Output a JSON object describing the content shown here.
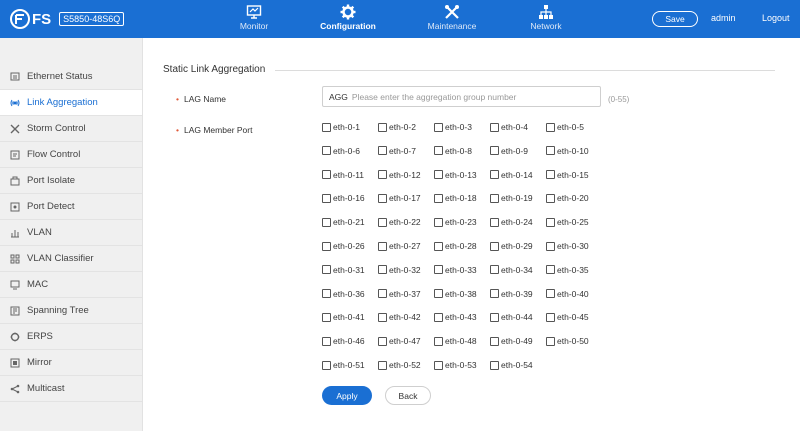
{
  "header": {
    "brand": "FS",
    "model": "S5850-48S6Q",
    "nav": [
      {
        "label": "Monitor",
        "icon": "monitor-icon"
      },
      {
        "label": "Configuration",
        "icon": "gear-icon",
        "active": true
      },
      {
        "label": "Maintenance",
        "icon": "tools-icon"
      },
      {
        "label": "Network",
        "icon": "network-icon"
      }
    ],
    "save_label": "Save",
    "user": "admin",
    "logout_label": "Logout",
    "bar_color": "#1a6fd3"
  },
  "sidebar": {
    "items": [
      {
        "label": "Ethernet Status",
        "icon": "ethernet-icon"
      },
      {
        "label": "Link Aggregation",
        "icon": "link-aggregation-icon",
        "active": true
      },
      {
        "label": "Storm Control",
        "icon": "storm-icon"
      },
      {
        "label": "Flow Control",
        "icon": "flow-icon"
      },
      {
        "label": "Port Isolate",
        "icon": "isolate-icon"
      },
      {
        "label": "Port Detect",
        "icon": "detect-icon"
      },
      {
        "label": "VLAN",
        "icon": "vlan-icon"
      },
      {
        "label": "VLAN Classifier",
        "icon": "classifier-icon"
      },
      {
        "label": "MAC",
        "icon": "mac-icon"
      },
      {
        "label": "Spanning Tree",
        "icon": "tree-icon"
      },
      {
        "label": "ERPS",
        "icon": "erps-icon"
      },
      {
        "label": "Mirror",
        "icon": "mirror-icon"
      },
      {
        "label": "Multicast",
        "icon": "multicast-icon"
      }
    ]
  },
  "main": {
    "section_title": "Static Link Aggregation",
    "lag_name_label": "LAG Name",
    "lag_name_value": "AGG",
    "lag_name_placeholder": "Please enter the aggregation group number",
    "lag_name_range": "(0-55)",
    "lag_member_label": "LAG Member Port",
    "ports": [
      "eth-0-1",
      "eth-0-2",
      "eth-0-3",
      "eth-0-4",
      "eth-0-5",
      "eth-0-6",
      "eth-0-7",
      "eth-0-8",
      "eth-0-9",
      "eth-0-10",
      "eth-0-11",
      "eth-0-12",
      "eth-0-13",
      "eth-0-14",
      "eth-0-15",
      "eth-0-16",
      "eth-0-17",
      "eth-0-18",
      "eth-0-19",
      "eth-0-20",
      "eth-0-21",
      "eth-0-22",
      "eth-0-23",
      "eth-0-24",
      "eth-0-25",
      "eth-0-26",
      "eth-0-27",
      "eth-0-28",
      "eth-0-29",
      "eth-0-30",
      "eth-0-31",
      "eth-0-32",
      "eth-0-33",
      "eth-0-34",
      "eth-0-35",
      "eth-0-36",
      "eth-0-37",
      "eth-0-38",
      "eth-0-39",
      "eth-0-40",
      "eth-0-41",
      "eth-0-42",
      "eth-0-43",
      "eth-0-44",
      "eth-0-45",
      "eth-0-46",
      "eth-0-47",
      "eth-0-48",
      "eth-0-49",
      "eth-0-50",
      "eth-0-51",
      "eth-0-52",
      "eth-0-53",
      "eth-0-54"
    ],
    "apply_label": "Apply",
    "back_label": "Back"
  }
}
